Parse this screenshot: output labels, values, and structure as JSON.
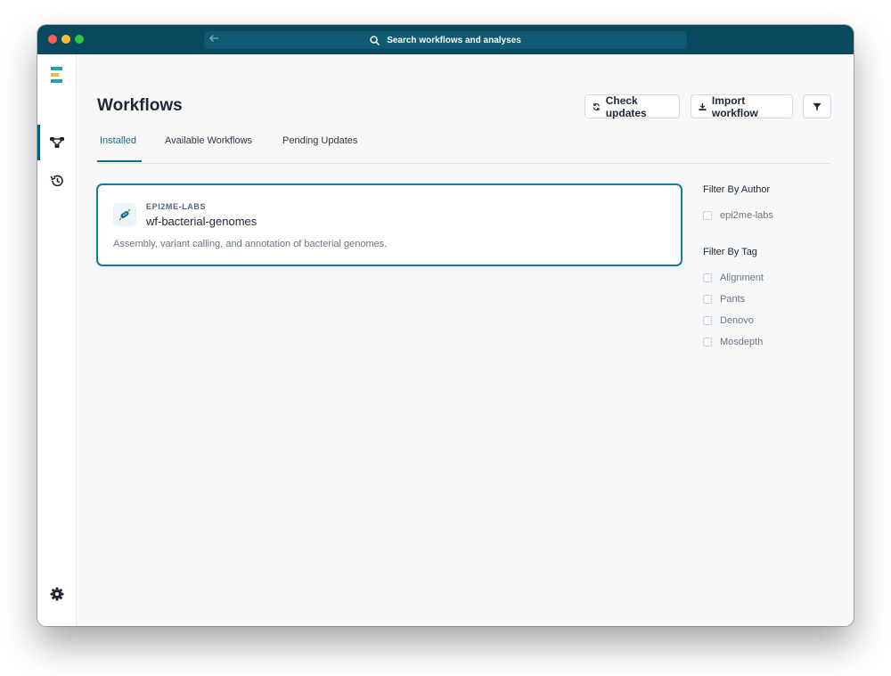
{
  "app": {
    "search_placeholder": "Search workflows and analyses",
    "accent_color": "#0b6e8c",
    "titlebar_color": "#0b4a5e"
  },
  "sidebar": {
    "items": [
      {
        "name": "logo",
        "icon": "app-logo-icon"
      },
      {
        "name": "workflows",
        "icon": "workflow-icon",
        "active": true
      },
      {
        "name": "history",
        "icon": "history-icon"
      },
      {
        "name": "settings",
        "icon": "gear-icon"
      },
      {
        "name": "account",
        "icon": "user-circle-icon"
      }
    ]
  },
  "header": {
    "title": "Workflows",
    "check_updates_label": "Check updates",
    "import_workflow_label": "Import workflow",
    "filter_icon": "filter-icon"
  },
  "tabs": [
    {
      "label": "Installed",
      "active": true
    },
    {
      "label": "Available Workflows",
      "active": false
    },
    {
      "label": "Pending Updates",
      "active": false
    }
  ],
  "workflows": [
    {
      "author": "EPI2ME-LABS",
      "name": "wf-bacterial-genomes",
      "description": "Assembly, variant calling, and annotation of bacterial genomes.",
      "icon": "bacteria-icon"
    }
  ],
  "filters": {
    "author_heading": "Filter By Author",
    "authors": [
      "epi2me-labs"
    ],
    "tag_heading": "Filter By Tag",
    "tags": [
      "Alignment",
      "Pants",
      "Denovo",
      "Mosdepth"
    ]
  }
}
